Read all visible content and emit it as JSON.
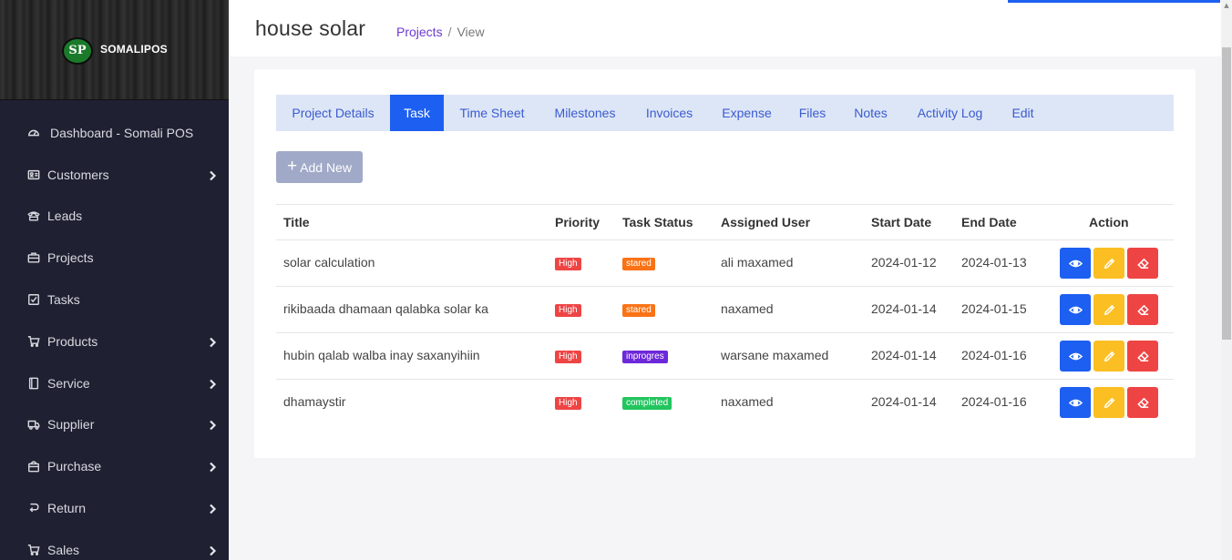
{
  "brand": {
    "logo_text": "SP",
    "name": "SOMALIPOS"
  },
  "sidebar": {
    "items": [
      {
        "label": "Dashboard - Somali POS",
        "icon": "dashboard-icon",
        "has_submenu": false
      },
      {
        "label": "Customers",
        "icon": "id-card-icon",
        "has_submenu": true
      },
      {
        "label": "Leads",
        "icon": "phone-icon",
        "has_submenu": false
      },
      {
        "label": "Projects",
        "icon": "briefcase-icon",
        "has_submenu": false
      },
      {
        "label": "Tasks",
        "icon": "checkbox-icon",
        "has_submenu": false
      },
      {
        "label": "Products",
        "icon": "cart-icon",
        "has_submenu": true
      },
      {
        "label": "Service",
        "icon": "book-icon",
        "has_submenu": true
      },
      {
        "label": "Supplier",
        "icon": "truck-icon",
        "has_submenu": true
      },
      {
        "label": "Purchase",
        "icon": "bag-icon",
        "has_submenu": true
      },
      {
        "label": "Return",
        "icon": "return-icon",
        "has_submenu": true
      },
      {
        "label": "Sales",
        "icon": "cart-icon",
        "has_submenu": true
      }
    ]
  },
  "header": {
    "title": "house solar",
    "breadcrumb": {
      "link": "Projects",
      "separator": "/",
      "current": "View"
    }
  },
  "tabs": [
    {
      "label": "Project Details",
      "active": false
    },
    {
      "label": "Task",
      "active": true
    },
    {
      "label": "Time Sheet",
      "active": false
    },
    {
      "label": "Milestones",
      "active": false
    },
    {
      "label": "Invoices",
      "active": false
    },
    {
      "label": "Expense",
      "active": false
    },
    {
      "label": "Files",
      "active": false
    },
    {
      "label": "Notes",
      "active": false
    },
    {
      "label": "Activity Log",
      "active": false
    },
    {
      "label": "Edit",
      "active": false
    }
  ],
  "add_button": {
    "label": "Add New"
  },
  "table": {
    "columns": [
      "Title",
      "Priority",
      "Task Status",
      "Assigned User",
      "Start Date",
      "End Date",
      "Action"
    ],
    "rows": [
      {
        "title": "solar calculation",
        "priority": "High",
        "status": "stared",
        "user": "ali maxamed",
        "start": "2024-01-12",
        "end": "2024-01-13"
      },
      {
        "title": "rikibaada dhamaan qalabka solar ka",
        "priority": "High",
        "status": "stared",
        "user": "naxamed",
        "start": "2024-01-14",
        "end": "2024-01-15"
      },
      {
        "title": "hubin qalab walba inay saxanyihiin",
        "priority": "High",
        "status": "inprogres",
        "user": "warsane maxamed",
        "start": "2024-01-14",
        "end": "2024-01-16"
      },
      {
        "title": "dhamaystir",
        "priority": "High",
        "status": "completed",
        "user": "naxamed",
        "start": "2024-01-14",
        "end": "2024-01-16"
      }
    ]
  },
  "colors": {
    "sidebar_bg": "#1f2132",
    "primary": "#1d5ff0",
    "priority_high": "#ef4444",
    "status_stared": "#f97316",
    "status_inprogres": "#6d28d9",
    "status_completed": "#22c55e",
    "view_button": "#1d5ff0",
    "edit_button": "#fbbf24",
    "delete_button": "#ef4444"
  }
}
